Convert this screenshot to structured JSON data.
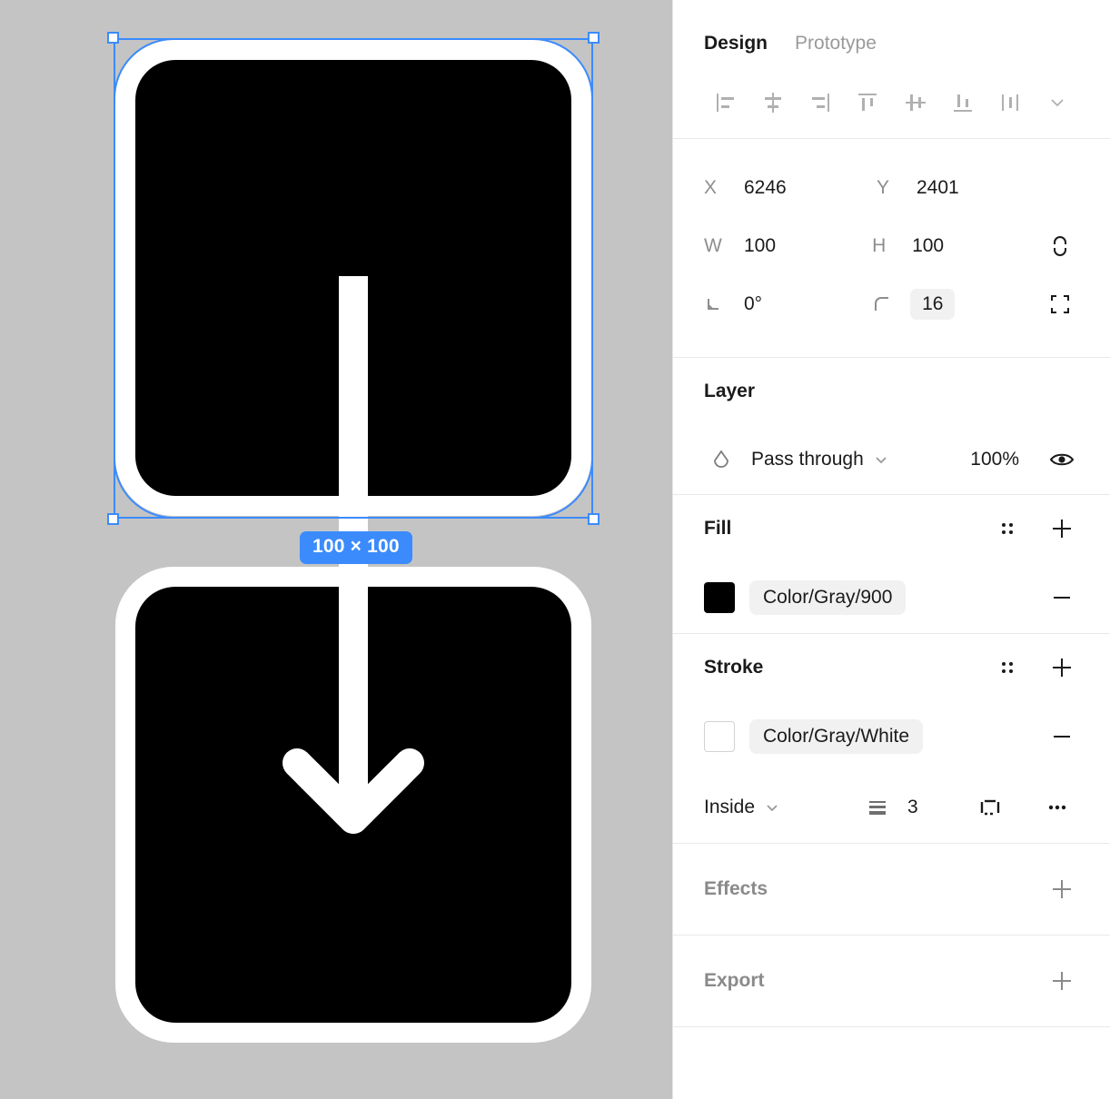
{
  "canvas": {
    "background_color": "#c4c4c4",
    "selection": {
      "size_badge": "100 × 100",
      "accent_color": "#3b8bfd"
    },
    "artboards": [
      {
        "name": "arrow-down-icon-top-half",
        "fill_color": "#000000",
        "stroke_color": "#ffffff"
      },
      {
        "name": "arrow-down-icon-bottom-half",
        "fill_color": "#000000",
        "stroke_color": "#ffffff"
      }
    ]
  },
  "panel": {
    "tabs": [
      {
        "label": "Design",
        "active": true
      },
      {
        "label": "Prototype",
        "active": false
      }
    ],
    "align_tools": [
      {
        "name": "align-left-icon"
      },
      {
        "name": "align-horizontal-center-icon"
      },
      {
        "name": "align-right-icon"
      },
      {
        "name": "align-top-icon"
      },
      {
        "name": "align-vertical-center-icon"
      },
      {
        "name": "align-bottom-icon"
      },
      {
        "name": "distribute-icon"
      }
    ],
    "properties": {
      "x_label": "X",
      "x_value": "6246",
      "y_label": "Y",
      "y_value": "2401",
      "w_label": "W",
      "w_value": "100",
      "h_label": "H",
      "h_value": "100",
      "rotation_value": "0°",
      "corner_radius_value": "16"
    },
    "layer": {
      "title": "Layer",
      "blend_mode": "Pass through",
      "opacity": "100%"
    },
    "fill": {
      "title": "Fill",
      "color_hex": "#000000",
      "token": "Color/Gray/900"
    },
    "stroke": {
      "title": "Stroke",
      "color_hex": "#ffffff",
      "token": "Color/Gray/White",
      "position": "Inside",
      "weight": "3"
    },
    "effects": {
      "title": "Effects"
    },
    "export": {
      "title": "Export"
    }
  }
}
